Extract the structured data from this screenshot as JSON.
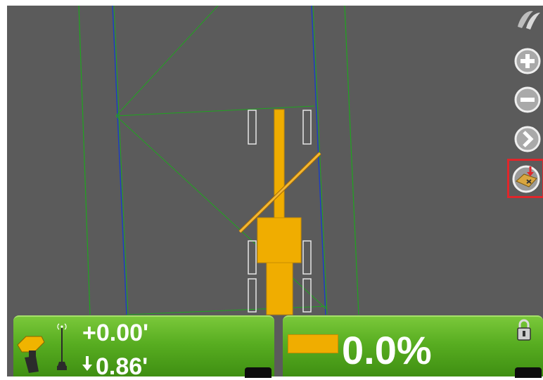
{
  "guidance": {
    "elevation_offset": "+0.00'",
    "cut_fill": "0.86'",
    "slope_percent": "0.0%"
  },
  "toolbar": {
    "buttons": [
      {
        "icon": "plus-icon"
      },
      {
        "icon": "minus-icon"
      },
      {
        "icon": "chevron-right-icon"
      },
      {
        "icon": "export-map-icon",
        "highlighted": true
      }
    ]
  },
  "colors": {
    "background": "#5b5b5b",
    "machine": "#f0ad00",
    "design_line": "#1fa51f",
    "alignment_line": "#1f3fbf",
    "panel_green": "#58ad21",
    "highlight": "#e0262b"
  }
}
